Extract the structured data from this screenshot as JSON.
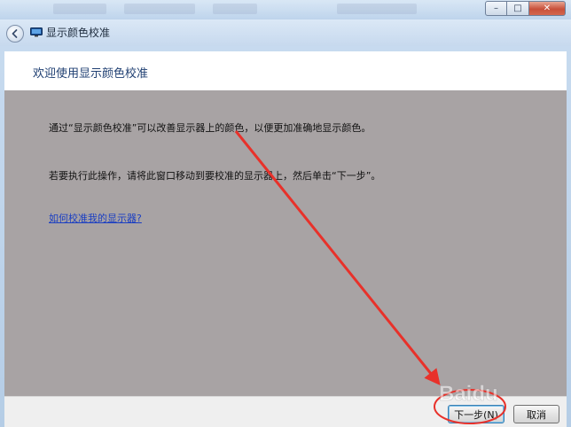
{
  "window": {
    "minimize_glyph": "–",
    "maximize_glyph": "□",
    "close_glyph": "✕"
  },
  "navbar": {
    "title": "显示颜色校准"
  },
  "header": {
    "title": "欢迎使用显示颜色校准"
  },
  "content": {
    "paragraph_1": "通过“显示颜色校准”可以改善显示器上的颜色，以便更加准确地显示颜色。",
    "paragraph_2": "若要执行此操作，请将此窗口移动到要校准的显示器上，然后单击“下一步”。",
    "help_link": "如何校准我的显示器?"
  },
  "footer": {
    "next_label": "下一步(N)",
    "cancel_label": "取消"
  },
  "annotation": {
    "watermark": "Baidu"
  },
  "colors": {
    "content_bg": "#a8a3a4",
    "header_title": "#1f3f72",
    "link": "#1a3ec2",
    "arrow": "#e8312a"
  }
}
